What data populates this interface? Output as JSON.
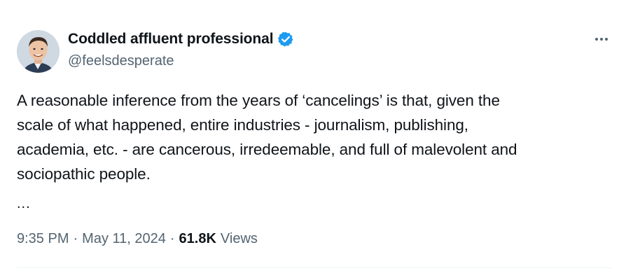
{
  "author": {
    "display_name": "Coddled affluent professional",
    "handle": "@feelsdesperate",
    "verified_icon": "verified-badge-icon",
    "verified_color": "#1d9bf0"
  },
  "tweet": {
    "lines": [
      "A reasonable inference from the years of ‘cancelings’ is that, given the",
      "scale of what happened, entire industries - journalism, publishing,",
      "academia, etc. - are cancerous, irredeemable, and full of malevolent and",
      "sociopathic people."
    ],
    "ellipsis": "..."
  },
  "meta": {
    "time": "9:35 PM",
    "separator": "·",
    "date": "May 11, 2024",
    "views_count": "61.8K",
    "views_label": "Views"
  },
  "icons": {
    "more": "more-options-icon",
    "avatar": "avatar"
  },
  "colors": {
    "text": "#0f1419",
    "secondary": "#536471",
    "divider": "#eff3f4"
  }
}
